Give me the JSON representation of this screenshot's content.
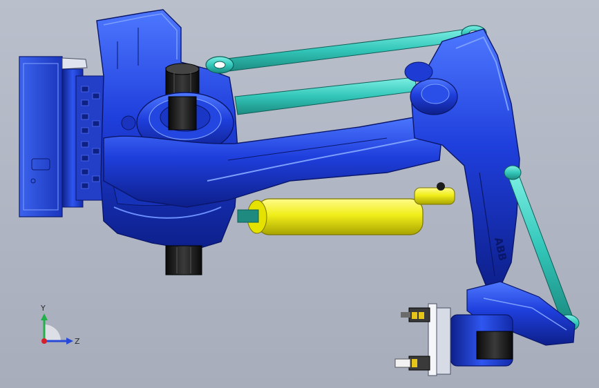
{
  "viewport": {
    "background_top": "#b9bfcb",
    "background_bottom": "#a7adbb"
  },
  "model": {
    "brand_mark": "ABB",
    "colors": {
      "arm_blue": "#1f3fdc",
      "arm_dark": "#0d1f8a",
      "arm_light": "#5f86ff",
      "link_teal": "#33c7ba",
      "cylinder_yellow": "#f1ee1a",
      "shaft_black": "#1c1c1c",
      "frame_blue": "#2f5ae8"
    }
  },
  "triad": {
    "y_label": "Y",
    "z_label": "Z",
    "y_color": "#22b04a",
    "z_color": "#2848d8",
    "x_color": "#d4202a"
  }
}
